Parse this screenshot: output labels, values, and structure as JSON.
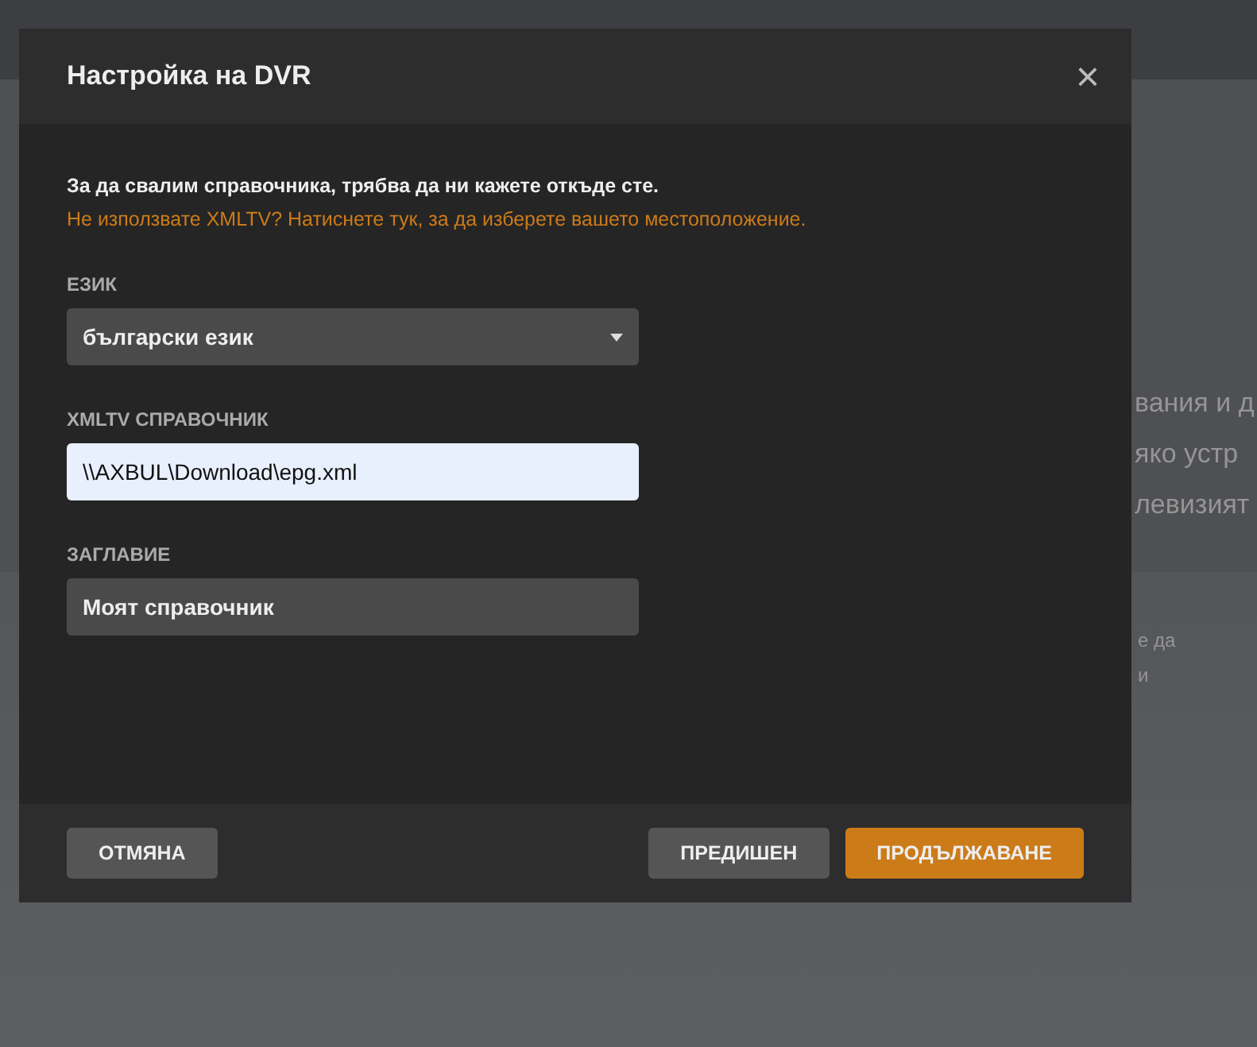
{
  "background": {
    "lines": [
      "вания и д",
      "яко устр",
      "левизият"
    ],
    "note_lines": [
      "е да",
      "и"
    ]
  },
  "dialog": {
    "title": "Настройка на DVR",
    "close": "×",
    "intro": "За да свалим справочника, трябва да ни кажете откъде сте.",
    "link": "Не използвате XMLTV? Натиснете тук, за да изберете вашето местоположение.",
    "fields": [
      {
        "kind": "select",
        "label": "ЕЗИК",
        "value": "български език"
      },
      {
        "kind": "input",
        "label": "XMLTV СПРАВОЧНИК",
        "value": "\\\\AXBUL\\Download\\epg.xml"
      },
      {
        "kind": "text",
        "label": "ЗАГЛАВИЕ",
        "value": "Моят справочник"
      }
    ],
    "buttons": [
      {
        "label": "ОТМЯНА",
        "kind": "secondary"
      },
      {
        "label": "ПРЕДИШЕН",
        "kind": "secondary"
      },
      {
        "label": "ПРОДЪЛЖАВАНЕ",
        "kind": "primary"
      }
    ]
  }
}
